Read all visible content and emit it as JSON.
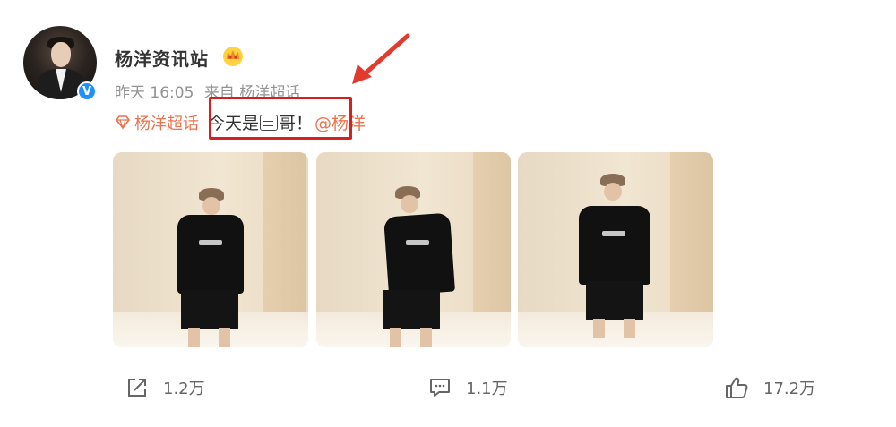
{
  "post": {
    "author": "杨洋资讯站",
    "time": "昨天 16:05",
    "source": "来自 杨洋超话",
    "topic": "杨洋超话",
    "text_before": "今天是",
    "text_after": "哥！",
    "mention": "@杨洋"
  },
  "icons": {
    "crown": "vip-crown-icon",
    "verified": "verified-badge-icon",
    "verified_glyph": "V",
    "topic": "diamond-topic-icon",
    "emoji": "emoji-placeholder-icon",
    "share": "share-icon",
    "comment": "comment-icon",
    "like": "like-icon"
  },
  "annotation": {
    "box_color": "#d62020",
    "arrow_color": "#e23a2e"
  },
  "photos": [
    {
      "alt": "photo 1"
    },
    {
      "alt": "photo 2"
    },
    {
      "alt": "photo 3"
    }
  ],
  "actions": {
    "share_count": "1.2万",
    "comment_count": "1.1万",
    "like_count": "17.2万"
  },
  "colors": {
    "accent": "#eb7350",
    "meta": "#939393"
  }
}
